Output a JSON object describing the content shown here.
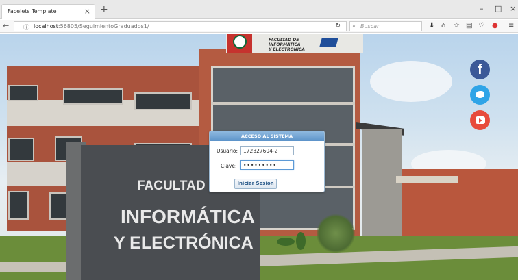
{
  "browser": {
    "tab_title": "Facelets Template",
    "tab_close": "×",
    "new_tab": "+",
    "url_host": "localhost",
    "url_path": ":56805/SeguimientoGraduados1/",
    "search_placeholder": "Buscar",
    "window_controls": [
      "–",
      "□",
      "×"
    ]
  },
  "banner": {
    "line1": "FACULTAD DE",
    "line2": "INFORMÁTICA",
    "line3": "Y ELECTRÓNICA"
  },
  "sign": {
    "line1": "FACULTAD DE",
    "line2": "INFORMÁTICA",
    "line3": "Y ELECTRÓNICA"
  },
  "social": {
    "facebook_icon": "facebook-icon",
    "facebook_glyph": "f",
    "twitter_icon": "twitter-icon",
    "youtube_icon": "youtube-icon"
  },
  "login": {
    "title": "ACCESO AL SISTEMA",
    "user_label": "Usuario:",
    "user_value": "172327604-2",
    "password_label": "Clave:",
    "password_value": "•••••••••",
    "submit_label": "Iniciar Sesión"
  },
  "colors": {
    "accent": "#5c93c9",
    "facebook": "#3b5998",
    "twitter": "#2fa4e7",
    "youtube": "#e74b3c"
  }
}
